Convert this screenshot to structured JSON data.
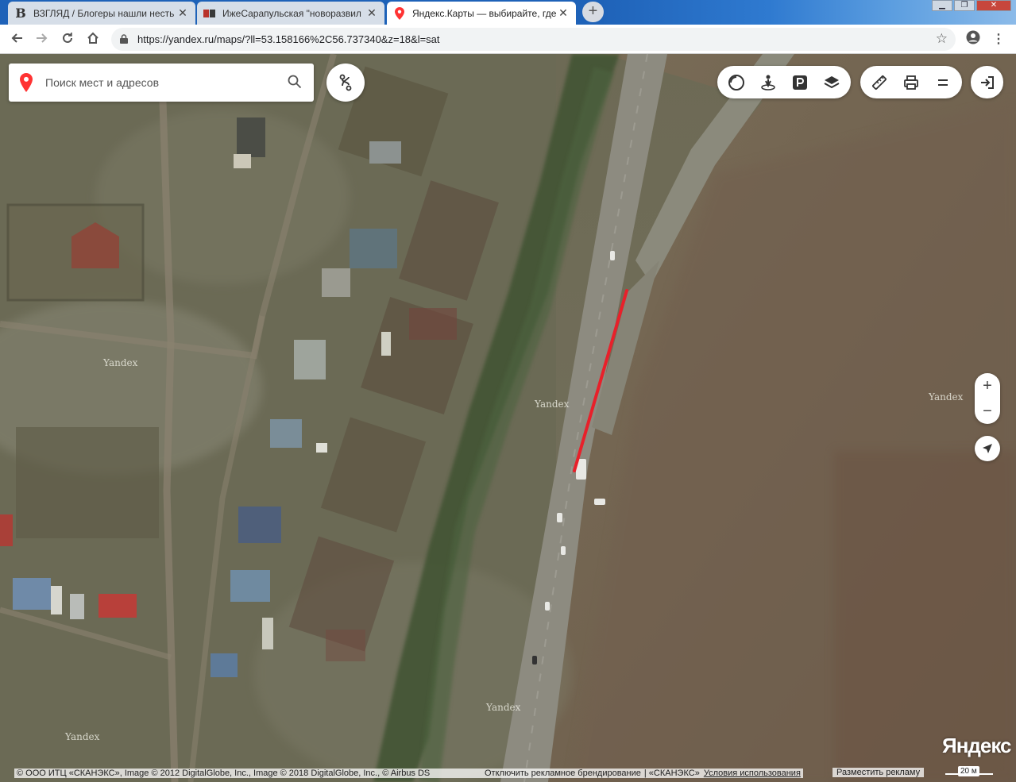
{
  "browser": {
    "tabs": [
      {
        "title": "ВЗГЛЯД / Блогеры нашли несть",
        "icon": "vzglyad-favicon",
        "active": false
      },
      {
        "title": "ИжеСарапульская \"новоразвил",
        "icon": "izhe-favicon",
        "active": false
      },
      {
        "title": "Яндекс.Карты — выбирайте, где",
        "icon": "yandex-maps-favicon",
        "active": true
      }
    ],
    "url": "https://yandex.ru/maps/?ll=53.158166%2C56.737340&z=18&l=sat",
    "tab_close_glyph": "✕",
    "new_tab_glyph": "+"
  },
  "map": {
    "search_placeholder": "Поиск мест и адресов",
    "watermark": "Yandex",
    "logo": "Яндекс",
    "zoom_in": "+",
    "zoom_out": "−",
    "scale": "20 м",
    "footer": {
      "copyright": "© ООО ИТЦ «СКАНЭКС», Image © 2012 DigitalGlobe, Inc., Image © 2018 DigitalGlobe, Inc., © Airbus DS",
      "branding": "Отключить рекламное брендирование",
      "scanex": "| «СКАНЭКС»",
      "terms": "Условия использования",
      "ads": "Разместить рекламу"
    },
    "toolbar_icons": [
      "traffic-icon",
      "panorama-icon",
      "parking-icon",
      "layers-icon"
    ],
    "tools_icons": [
      "ruler-icon",
      "print-icon",
      "menu-icon"
    ],
    "annotation_color": "#e8202a",
    "accent_red": "#ff3333"
  }
}
